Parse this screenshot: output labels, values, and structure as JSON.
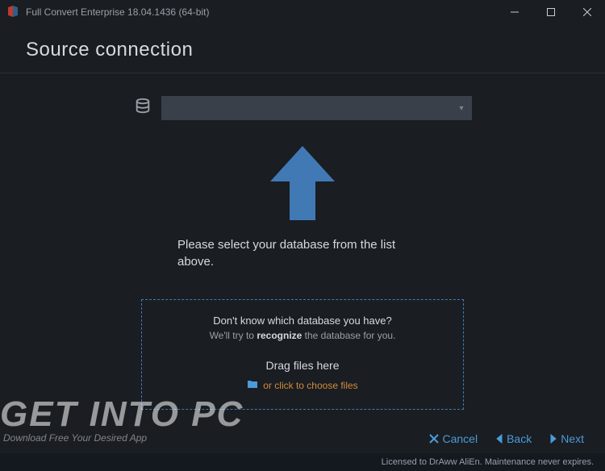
{
  "window": {
    "title": "Full Convert Enterprise 18.04.1436 (64-bit)"
  },
  "header": {
    "title": "Source connection"
  },
  "main": {
    "prompt": "Please select your database from the list above.",
    "dropzone": {
      "question": "Don't know which database you have?",
      "answer_pre": "We'll try to ",
      "answer_bold": "recognize",
      "answer_post": " the database for you.",
      "drag_label": "Drag files here",
      "choose_label": "or click to choose files"
    }
  },
  "nav": {
    "cancel": "Cancel",
    "back": "Back",
    "next": "Next"
  },
  "license": "Licensed to DrAww AliEn. Maintenance never expires.",
  "watermark": {
    "line1": "GET INTO PC",
    "line2": "Download Free Your Desired App"
  },
  "colors": {
    "accent_blue": "#4b9bd8",
    "dashed_blue": "#4179b5",
    "link_orange": "#d28a3a",
    "bg": "#1a1d22",
    "select_bg": "#3a4049"
  }
}
